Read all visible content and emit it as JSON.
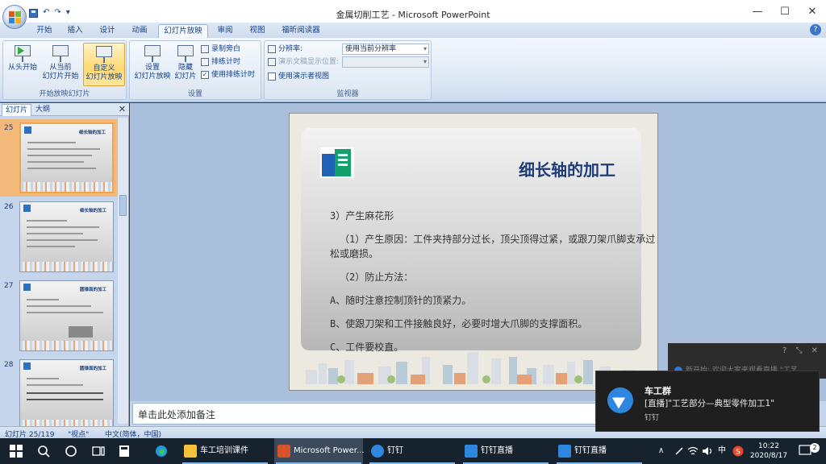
{
  "window": {
    "title": "金属切削工艺 - Microsoft PowerPoint",
    "minimize": "—",
    "maximize": "☐",
    "close": "✕"
  },
  "qat": {
    "undo": "↶",
    "redo": "↷",
    "more": "▾"
  },
  "tabs": [
    "开始",
    "插入",
    "设计",
    "动画",
    "幻灯片放映",
    "审阅",
    "视图",
    "福昕阅读器"
  ],
  "active_tab": "幻灯片放映",
  "ribbon": {
    "groups": {
      "start_slideshow": {
        "label": "开始放映幻灯片",
        "from_beginning": "从头开始",
        "from_current_1": "从当前",
        "from_current_2": "幻灯片开始",
        "custom_1": "自定义",
        "custom_2": "幻灯片放映"
      },
      "setup": {
        "label": "设置",
        "setup_1": "设置",
        "setup_2": "幻灯片放映",
        "hide_1": "隐藏",
        "hide_2": "幻灯片",
        "record_narration": "录制旁白",
        "rehearse_timings": "排练计时",
        "use_timings": "使用排练计时"
      },
      "monitors": {
        "label": "监视器",
        "resolution_label": "分辨率:",
        "resolution_value": "使用当前分辨率",
        "show_on_label": "演示文稿显示位置:",
        "presenter_view": "使用演示者视图"
      }
    }
  },
  "left_pane": {
    "tab_slides": "幻灯片",
    "tab_outline": "大纲",
    "close": "✕",
    "thumbnails": [
      {
        "num": "25",
        "title": "细长轴的加工"
      },
      {
        "num": "26",
        "title": "细长轴的加工"
      },
      {
        "num": "27",
        "title": "圆锥面的加工"
      },
      {
        "num": "28",
        "title": "圆锥面的加工"
      }
    ]
  },
  "slide": {
    "title": "细长轴的加工",
    "lines": [
      "3）产生麻花形",
      "（1）产生原因：工件夹持部分过长，顶尖顶得过紧，或跟刀架爪脚支承过松或磨损。",
      "（2）防止方法：",
      "A、随时注意控制顶针的顶紧力。",
      "B、使跟刀架和工件接触良好，必要时增大爪脚的支撑面积。",
      "C、工件要校直。"
    ]
  },
  "notes_placeholder": "单击此处添加备注",
  "status": {
    "slide_counter": "幻灯片 25/119",
    "theme": "\"视点\"",
    "language": "中文(简体，中国)"
  },
  "notification_back": {
    "text": "新开始: 欢迎大家来观看直播 \"工艺"
  },
  "notification": {
    "title": "车工群",
    "body": "[直播]\"工艺部分—典型零件加工1\"",
    "source": "钉钉"
  },
  "taskbar": {
    "items": [
      {
        "label": "车工培训课件",
        "color": "#f3c23a"
      },
      {
        "label": "Microsoft Power...",
        "color": "#d6532b"
      },
      {
        "label": "钉钉",
        "color": "#2e86de"
      },
      {
        "label": "钉钉直播",
        "color": "#2e86de"
      },
      {
        "label": "钉钉直播",
        "color": "#2e86de"
      }
    ],
    "ime": "中",
    "time": "10:22",
    "date": "2020/8/17",
    "notif_count": "2"
  },
  "colors": {
    "ribbon_text": "#15428b",
    "slide_title": "#1c3c78",
    "taskbar_bg": "#16232f",
    "highlight": "#ffd873"
  }
}
